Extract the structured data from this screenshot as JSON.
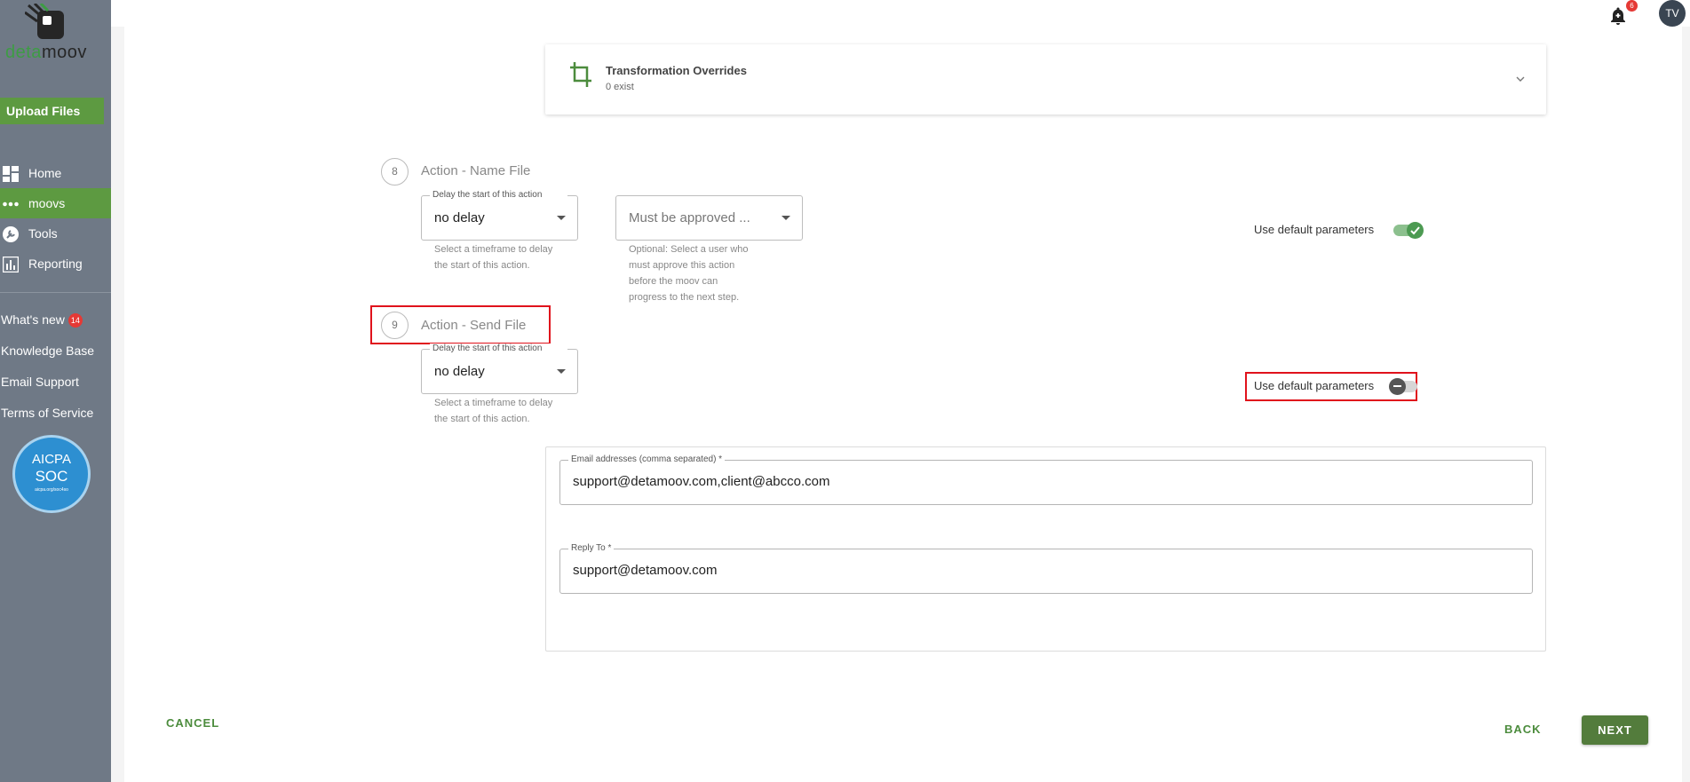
{
  "brand": {
    "logo_part1": "deta",
    "logo_part2": "moov"
  },
  "sidebar": {
    "upload_label": "Upload Files",
    "nav": [
      {
        "label": "Home",
        "icon": "dashboard-icon"
      },
      {
        "label": "moovs",
        "icon": "dots-icon",
        "active": true
      },
      {
        "label": "Tools",
        "icon": "wrench-icon"
      },
      {
        "label": "Reporting",
        "icon": "bar-chart-icon"
      }
    ],
    "links": {
      "whats_new": "What's new",
      "whats_new_count": "14",
      "knowledge_base": "Knowledge Base",
      "email_support": "Email Support",
      "terms": "Terms of Service"
    },
    "soc_badge": {
      "line1": "AICPA",
      "line2": "SOC",
      "line3": "aicpa.org/soc4so"
    }
  },
  "topbar": {
    "notification_count": "6",
    "avatar_initials": "TV"
  },
  "transformation": {
    "title": "Transformation Overrides",
    "subtitle": "0 exist"
  },
  "step8": {
    "number": "8",
    "title": "Action - Name File",
    "delay_legend": "Delay the start of this action",
    "delay_value": "no delay",
    "delay_helper_1": "Select a timeframe to delay",
    "delay_helper_2": "the start of this action.",
    "approval_value": "Must be approved ...",
    "approval_helper": [
      "Optional: Select a user who",
      "must approve this action",
      "before the moov can",
      "progress to the next step."
    ],
    "default_params_label": "Use default parameters"
  },
  "step9": {
    "number": "9",
    "title": "Action - Send File",
    "delay_legend": "Delay the start of this action",
    "delay_value": "no delay",
    "delay_helper_1": "Select a timeframe to delay",
    "delay_helper_2": "the start of this action.",
    "default_params_label": "Use default parameters",
    "email_legend": "Email addresses (comma separated) *",
    "email_value": "support@detamoov.com,client@abcco.com",
    "reply_legend": "Reply To *",
    "reply_value": "support@detamoov.com"
  },
  "footer": {
    "cancel": "CANCEL",
    "back": "BACK",
    "next": "NEXT"
  },
  "colors": {
    "sidebar": "#6f7986",
    "accent_green": "#5d9a41",
    "next_button": "#537c3c",
    "highlight_red": "#e0121c"
  }
}
